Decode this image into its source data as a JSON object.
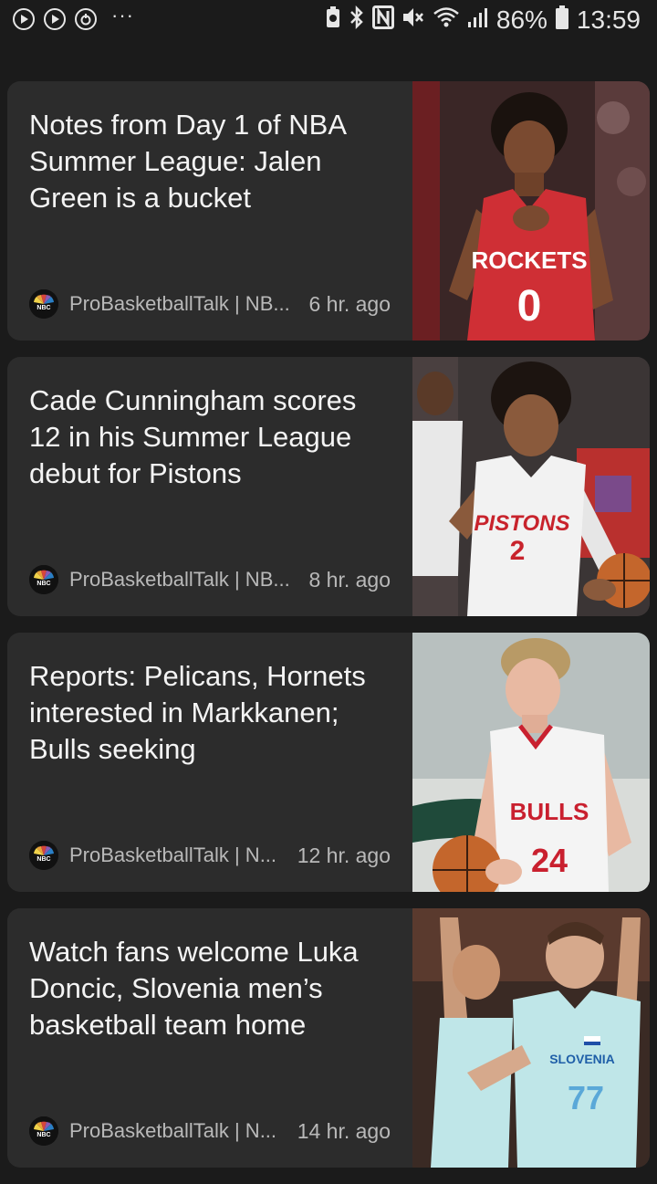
{
  "status_bar": {
    "battery": "86%",
    "time": "13:59",
    "left_icons": [
      "play-circle-icon",
      "play-circle-icon",
      "sync-circle-icon",
      "more-dots-icon"
    ],
    "right_icons": [
      "battery-saver-icon",
      "bluetooth-icon",
      "nfc-icon",
      "mute-icon",
      "wifi-icon",
      "signal-icon",
      "battery-icon"
    ]
  },
  "articles": [
    {
      "title": "Notes from Day 1 of NBA Summer League: Jalen Green is a bucket",
      "source": "ProBasketballTalk | NB...",
      "time": "6 hr. ago",
      "jersey_team": "ROCKETS",
      "jersey_number": "0",
      "jersey_color": "#cf2f35"
    },
    {
      "title": "Cade Cunningham scores 12 in his Summer League debut for Pistons",
      "source": "ProBasketballTalk | NB...",
      "time": "8 hr. ago",
      "jersey_team": "PISTONS",
      "jersey_number": "2",
      "jersey_color": "#f2f2f2"
    },
    {
      "title": "Reports: Pelicans, Hornets interested in Markkanen; Bulls seeking",
      "source": "ProBasketballTalk | N...",
      "time": "12 hr. ago",
      "jersey_team": "BULLS",
      "jersey_number": "24",
      "jersey_color": "#f4f4f4"
    },
    {
      "title": "Watch fans welcome Luka Doncic, Slovenia men’s basketball team home",
      "source": "ProBasketballTalk | N...",
      "time": "14 hr. ago",
      "jersey_team": "SLOVENIA",
      "jersey_number": "77",
      "jersey_color": "#bfe6e8"
    }
  ],
  "colors": {
    "background": "#1b1b1b",
    "card": "#2c2c2c",
    "title_text": "#f4f4f4",
    "meta_text": "#b9b9b9"
  }
}
